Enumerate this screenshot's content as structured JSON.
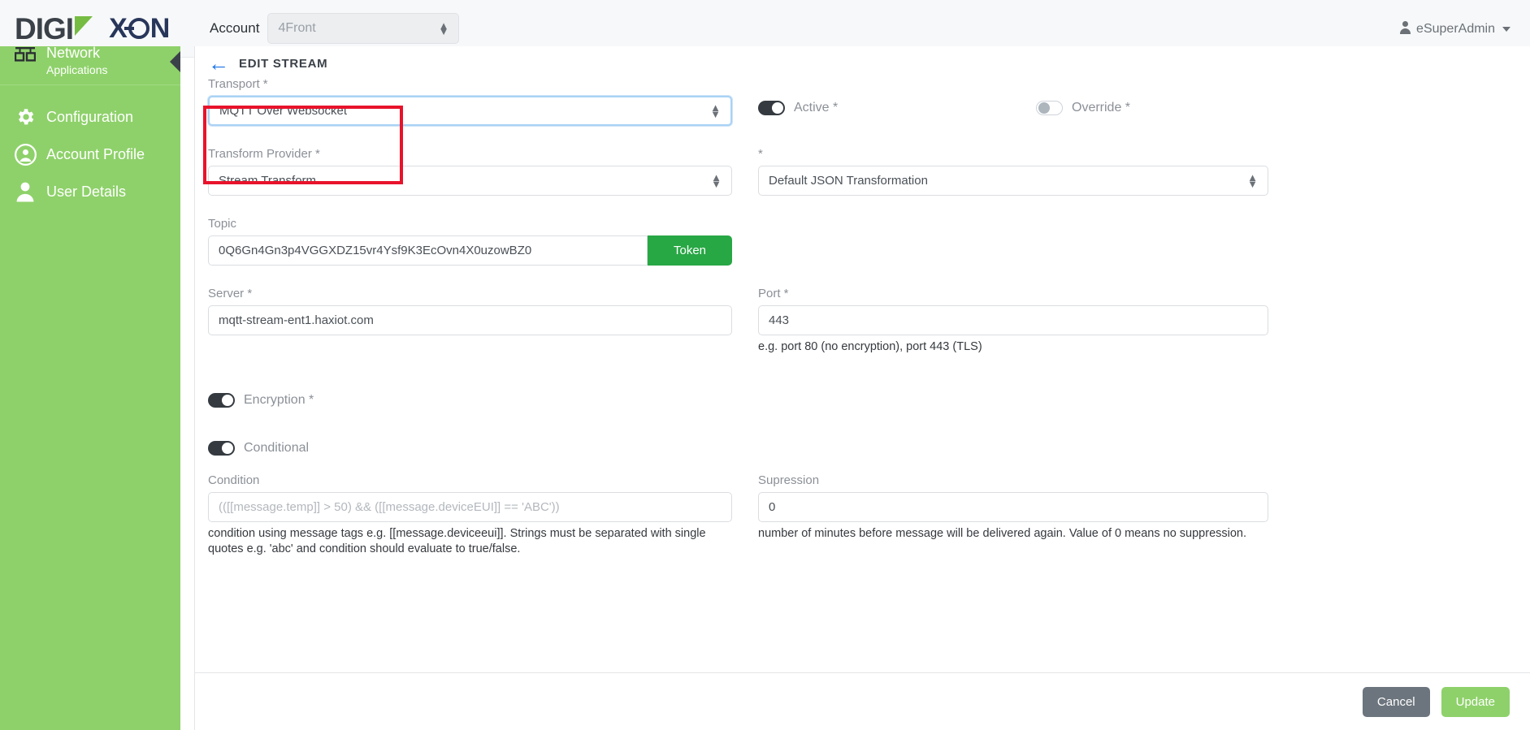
{
  "topbar": {
    "logo_digi": "DIGI",
    "logo_xon_left": "X",
    "logo_xon_right": "N",
    "account_label": "Account",
    "account_value": "4Front",
    "user_name": "eSuperAdmin"
  },
  "sidebar": {
    "items": [
      {
        "label": "Network",
        "sub": "Applications",
        "icon": "network-icon"
      },
      {
        "label": "Configuration",
        "sub": "",
        "icon": "gear-icon"
      },
      {
        "label": "Account Profile",
        "sub": "",
        "icon": "user-circle-icon"
      },
      {
        "label": "User Details",
        "sub": "",
        "icon": "person-icon"
      }
    ]
  },
  "page": {
    "title": "EDIT STREAM",
    "back_label": "←"
  },
  "form": {
    "transport": {
      "label": "Transport *",
      "value": "MQTT Over Websocket"
    },
    "active": {
      "label": "Active *",
      "state": "on"
    },
    "override": {
      "label": "Override *",
      "state": "off"
    },
    "transform_provider": {
      "label": "Transform Provider *",
      "value": "Stream Transform"
    },
    "transformation": {
      "label": "*",
      "value": "Default JSON Transformation"
    },
    "topic": {
      "label": "Topic",
      "value": "0Q6Gn4Gn3p4VGGXDZ15vr4Ysf9K3EcOvn4X0uzowBZ0",
      "token_button": "Token"
    },
    "server": {
      "label": "Server *",
      "value": "mqtt-stream-ent1.haxiot.com"
    },
    "port": {
      "label": "Port *",
      "value": "443",
      "hint": "e.g. port 80 (no encryption), port 443 (TLS)"
    },
    "encryption": {
      "label": "Encryption *",
      "state": "on"
    },
    "conditional": {
      "label": "Conditional",
      "state": "on"
    },
    "condition": {
      "label": "Condition",
      "placeholder": "(([[message.temp]] > 50) && ([[message.deviceEUI]] == 'ABC'))",
      "hint": "condition using message tags e.g. [[message.deviceeui]]. Strings must be separated with single quotes e.g. 'abc' and condition should evaluate to true/false."
    },
    "supression": {
      "label": "Supression",
      "value": "0",
      "hint": "number of minutes before message will be delivered again. Value of 0 means no suppression."
    }
  },
  "footer": {
    "cancel_label": "Cancel",
    "update_label": "Update"
  },
  "colors": {
    "sidebar_green": "#8ed16a",
    "token_green": "#28a745",
    "annotation_red": "#e8132b",
    "link_blue": "#1a73e8",
    "cancel_gray": "#6c757d"
  }
}
